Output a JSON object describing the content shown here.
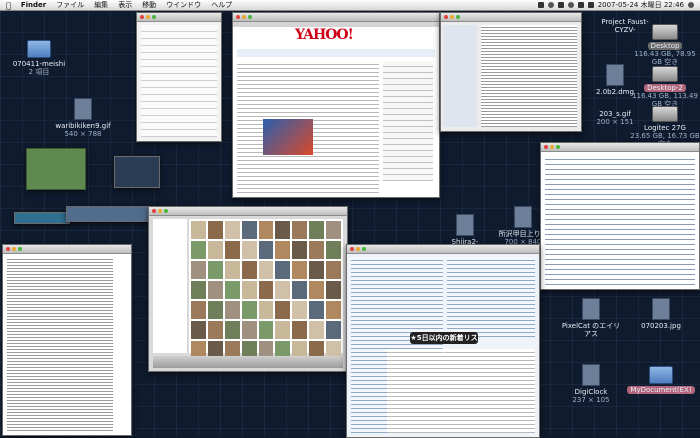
{
  "menubar": {
    "apple": "",
    "items": [
      "Finder",
      "ファイル",
      "編集",
      "表示",
      "移動",
      "ウインドウ",
      "ヘルプ"
    ],
    "clock": "2007-05-24 木曜日 22:46"
  },
  "desktop_icons": {
    "folder1": {
      "name": "070411-meishi",
      "sub": "2 項目"
    },
    "gif1": {
      "name": "waribikiken9.gif",
      "sub": "540 × 788"
    },
    "proj": {
      "name": "Project Faust-CYZV-"
    },
    "desktop1": {
      "name": "Desktop",
      "sub": "116.43 GB, 78.95 GB 空き"
    },
    "dmg1": {
      "name": "2.0b2.dmg"
    },
    "desktop2": {
      "name": "Desktop-2",
      "sub": "116.43 GB, 113.49 GB 空き"
    },
    "gif2": {
      "name": "203_s.gif",
      "sub": "200 × 151"
    },
    "logitec": {
      "name": "Logitec 27G",
      "sub": "23.65 GB, 16.73 GB 空き"
    },
    "shiira": {
      "name": "Shiira2-1.0b2.dmg"
    },
    "jpg1": {
      "name": "所沢甲目上り...",
      "sub": "700 × 840"
    },
    "pixelcat": {
      "name": "PixelCat のエイリアス"
    },
    "jpg2": {
      "name": "070203.jpg"
    },
    "digiclock": {
      "name": "DigiClock",
      "sub": "237 × 105"
    },
    "mydoc": {
      "name": "MyDocument(EX)"
    }
  },
  "yahoo": {
    "logo": "YAHOO!"
  },
  "news_banner": {
    "label": "★5日以内の新着リスト"
  },
  "colors": {
    "menubar": "#e6e6e6",
    "desktop": "#0f1b2e",
    "selection": "#3875d7"
  }
}
